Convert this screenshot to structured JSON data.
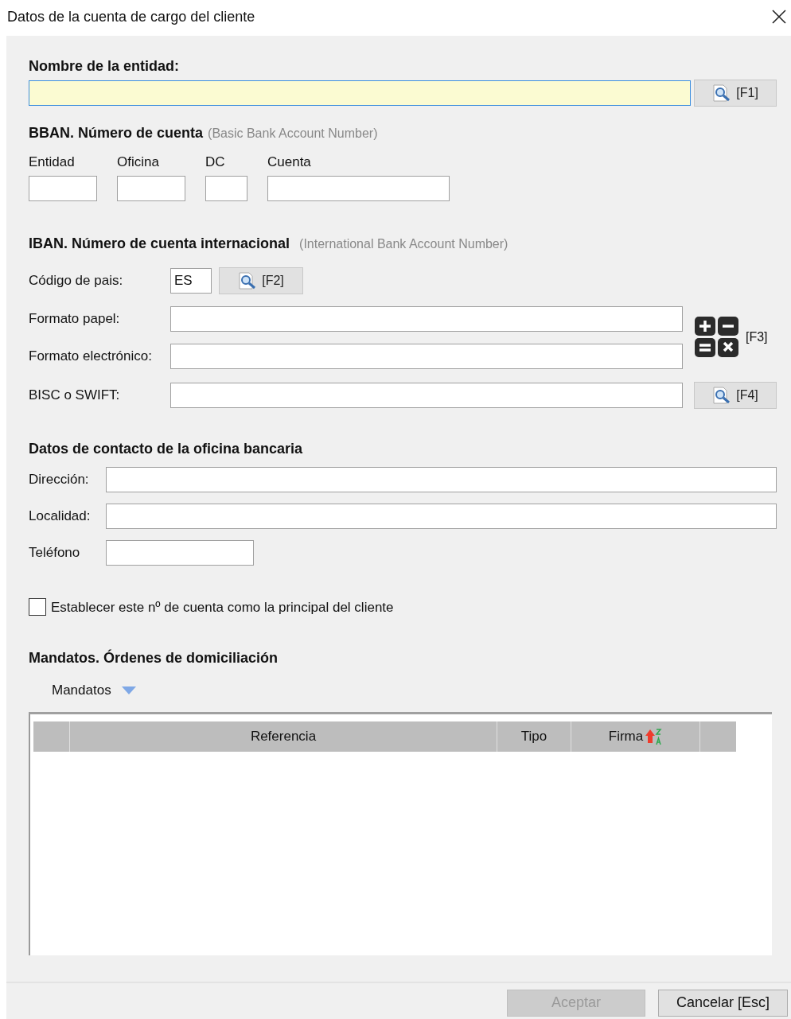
{
  "window": {
    "title": "Datos de la cuenta de cargo del cliente"
  },
  "entity": {
    "label": "Nombre de la entidad:",
    "focused": true,
    "button": "[F1]"
  },
  "bban": {
    "title": "BBAN. Número de cuenta",
    "subtitle": "(Basic Bank Account Number)",
    "fields": [
      {
        "label": "Entidad",
        "kind": "medium"
      },
      {
        "label": "Oficina",
        "kind": "medium"
      },
      {
        "label": "DC",
        "kind": "small"
      },
      {
        "label": "Cuenta",
        "kind": "large"
      }
    ]
  },
  "iban": {
    "title": "IBAN. Número de cuenta internacional",
    "subtitle": "(International Bank Account Number)",
    "country": {
      "label": "Código de  pais:",
      "value": "ES",
      "button": "[F2]"
    },
    "fields": [
      {
        "label": "Formato papel:"
      },
      {
        "label": "Formato electrónico:"
      }
    ],
    "calc_button": "[F3]",
    "swift": {
      "label": "BISC o SWIFT:",
      "button": "[F4]"
    }
  },
  "contact": {
    "title": "Datos de contacto de la oficina bancaria",
    "fields": [
      {
        "label": "Dirección:",
        "kind": "wide"
      },
      {
        "label": "Localidad:",
        "kind": "wide"
      },
      {
        "label": "Teléfono",
        "kind": "short"
      }
    ]
  },
  "main_account": {
    "label": "Establecer este nº de cuenta como la principal del cliente",
    "checked": false
  },
  "mandates": {
    "title": "Mandatos. Órdenes de domiciliación",
    "menu": "Mandatos",
    "columns": [
      {
        "label": "Referencia",
        "sorted": false
      },
      {
        "label": "Tipo",
        "sorted": false
      },
      {
        "label": "Firma",
        "sorted": true
      }
    ]
  },
  "buttons": [
    {
      "label": "Aceptar",
      "disabled": true
    },
    {
      "label": "Cancelar [Esc]",
      "disabled": false
    }
  ]
}
